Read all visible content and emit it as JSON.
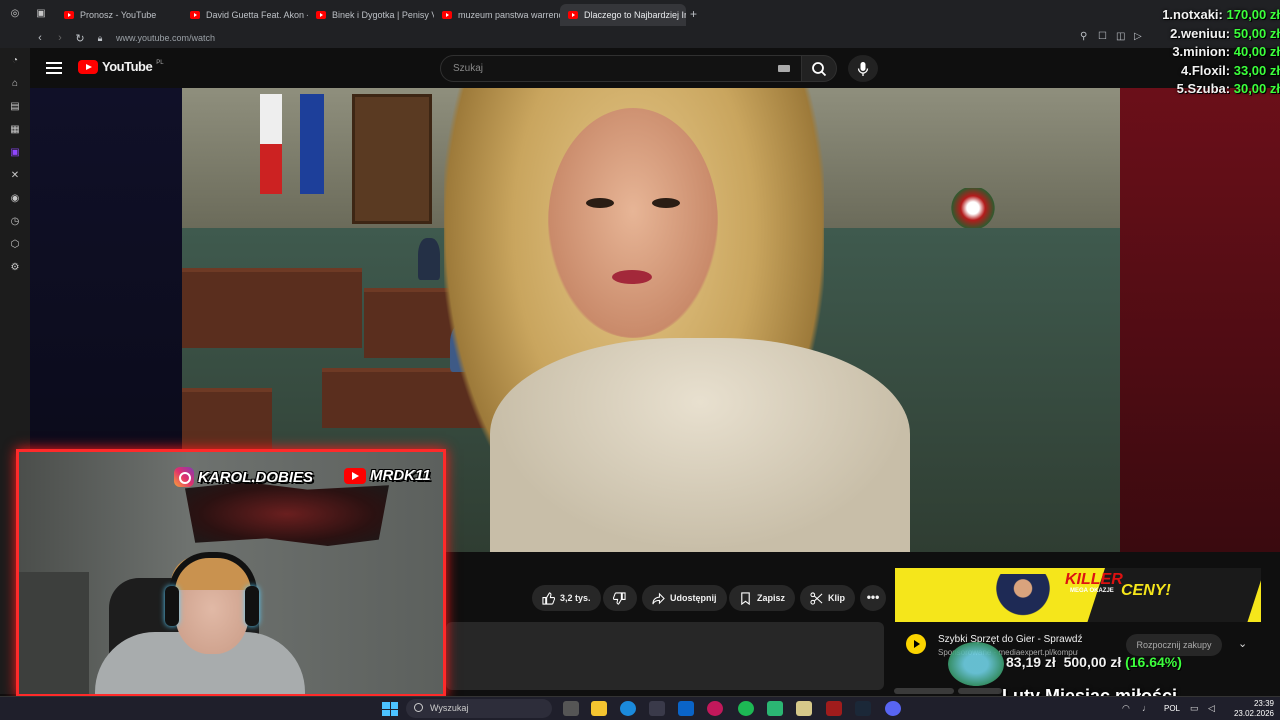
{
  "browser": {
    "tabs": [
      {
        "label": "Pronosz - YouTube",
        "active": false
      },
      {
        "label": "David Guetta Feat. Akon -",
        "active": false
      },
      {
        "label": "Binek i Dygotka | Penisy V",
        "active": false
      },
      {
        "label": "muzeum panstwa warrenc",
        "active": false
      },
      {
        "label": "Dlaczego to Najbardziej In",
        "active": true
      }
    ],
    "new_tab_glyph": "+",
    "url": "www.youtube.com/watch"
  },
  "youtube": {
    "logo_text": "YouTube",
    "country_code": "PL",
    "search_placeholder": "Szukaj",
    "actions": {
      "like_count": "3,2 tys.",
      "share_label": "Udostępnij",
      "save_label": "Zapisz",
      "clip_label": "Klip",
      "more_glyph": "•••"
    },
    "ad": {
      "banner_killer": "KILLER",
      "banner_mega": "MEGA OKAZJE",
      "banner_ceny": "CENY!",
      "title": "Szybki Sprzęt do Gier - Sprawdź",
      "sponsor": "Sponsorowane · mediaexpert.pl/komputery/ga...",
      "cta": "Rozpocznij zakupy"
    }
  },
  "overlay": {
    "donations": [
      {
        "rank": "1.",
        "name": "notxaki:",
        "amount": "170,00 zł"
      },
      {
        "rank": "2.",
        "name": "weniuu:",
        "amount": "50,00 zł"
      },
      {
        "rank": "3.",
        "name": "minion:",
        "amount": "40,00 zł"
      },
      {
        "rank": "4.",
        "name": "Floxil:",
        "amount": "33,00 zł"
      },
      {
        "rank": "5.",
        "name": "Szuba:",
        "amount": "30,00 zł"
      }
    ],
    "tip_current": "83,19 zł",
    "tip_goal": "500,00 zł",
    "tip_percent": "(16.64%)",
    "tip_fraction": 0.1664,
    "banner_text": "Luty Miesiąc miłości",
    "instagram_handle": "KAROL.DOBIES",
    "youtube_handle": "MRDK11"
  },
  "taskbar": {
    "search_placeholder": "Wyszukaj",
    "language": "POL",
    "time": "23:39",
    "date": "23.02.2026"
  },
  "colors": {
    "accent_red": "#ff0000",
    "donation_green": "#3cff3c",
    "webcam_border": "#ff2a2a",
    "ad_yellow": "#f5e61b"
  }
}
